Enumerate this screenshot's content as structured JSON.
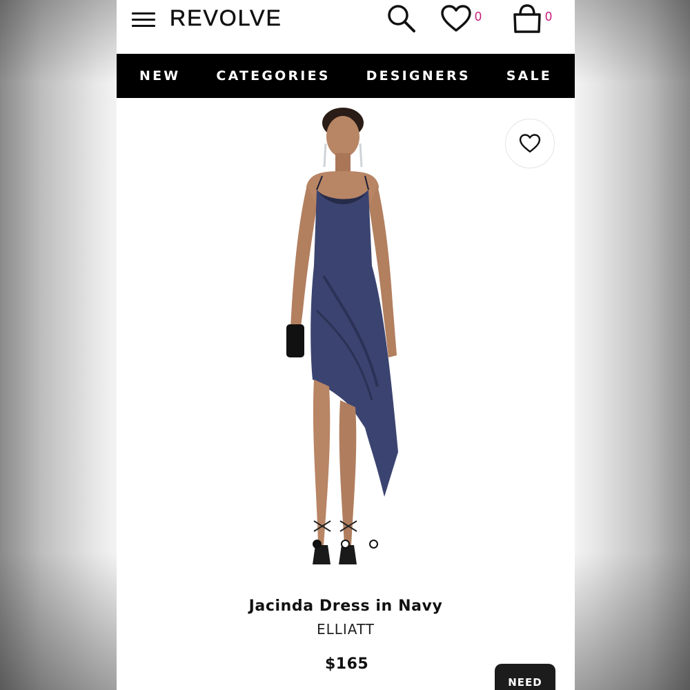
{
  "header": {
    "logo": "REVOLVE",
    "wishlist_count": "0",
    "bag_count": "0"
  },
  "nav": {
    "items": [
      {
        "label": "NEW"
      },
      {
        "label": "CATEGORIES"
      },
      {
        "label": "DESIGNERS"
      },
      {
        "label": "SALE"
      }
    ]
  },
  "gallery": {
    "image_count": 3,
    "active_index": 0
  },
  "product": {
    "name": "Jacinda Dress in Navy",
    "brand": "ELLIATT",
    "price": "$165"
  },
  "cta": {
    "label": "NEED"
  },
  "colors": {
    "nav_bg": "#000000",
    "badge": "#c2187a",
    "dress": "#3b4470"
  }
}
